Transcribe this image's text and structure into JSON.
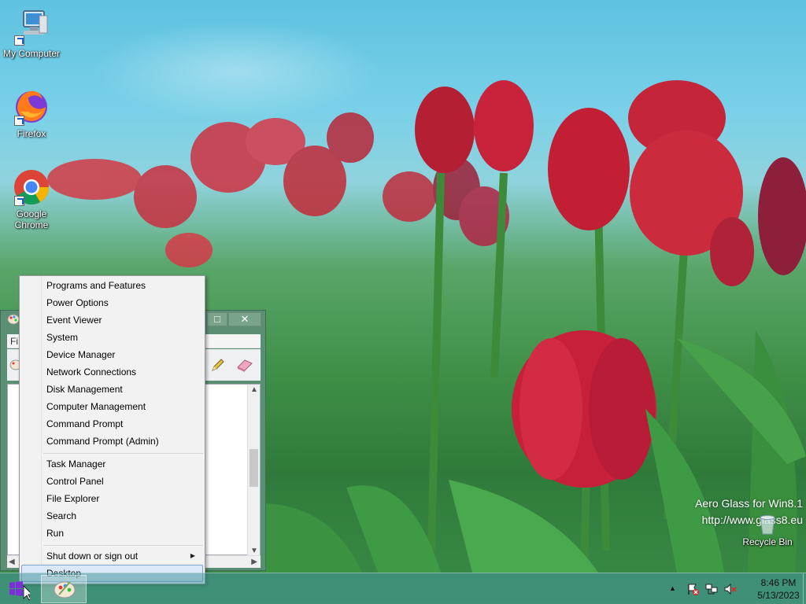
{
  "desktop": {
    "icons": [
      {
        "label": "My Computer",
        "icon": "computer-icon"
      },
      {
        "label": "Firefox",
        "icon": "firefox-icon"
      },
      {
        "label": "Google Chrome",
        "icon": "chrome-icon"
      }
    ],
    "recycle_bin": {
      "label": "Recycle Bin",
      "icon": "recycle-bin-icon"
    },
    "watermark": {
      "line1": "Aero Glass for Win8.1",
      "line2": "http://www.glass8.eu"
    }
  },
  "background_window": {
    "app": "Paint",
    "menu_first_letter": "Fi",
    "buttons": {
      "maximize": "□",
      "close": "✕"
    }
  },
  "context_menu": {
    "group1": [
      "Programs and Features",
      "Power Options",
      "Event Viewer",
      "System",
      "Device Manager",
      "Network Connections",
      "Disk Management",
      "Computer Management",
      "Command Prompt",
      "Command Prompt (Admin)"
    ],
    "group2": [
      "Task Manager",
      "Control Panel",
      "File Explorer",
      "Search",
      "Run"
    ],
    "group3": [
      {
        "label": "Shut down or sign out",
        "submenu": true
      },
      {
        "label": "Desktop",
        "highlighted": true
      }
    ]
  },
  "taskbar": {
    "clock": {
      "time": "8:46 PM",
      "date": "5/13/2023"
    },
    "tray_icons": [
      "show-hidden-icons-icon",
      "action-center-flag-icon",
      "network-icon",
      "volume-muted-icon"
    ],
    "pinned": [
      "start-icon",
      "paint-taskbar-icon"
    ]
  },
  "colors": {
    "menu_highlight": "#dbe8f7",
    "menu_highlight_border": "#7da2ce",
    "taskbar": "#4696a0"
  }
}
